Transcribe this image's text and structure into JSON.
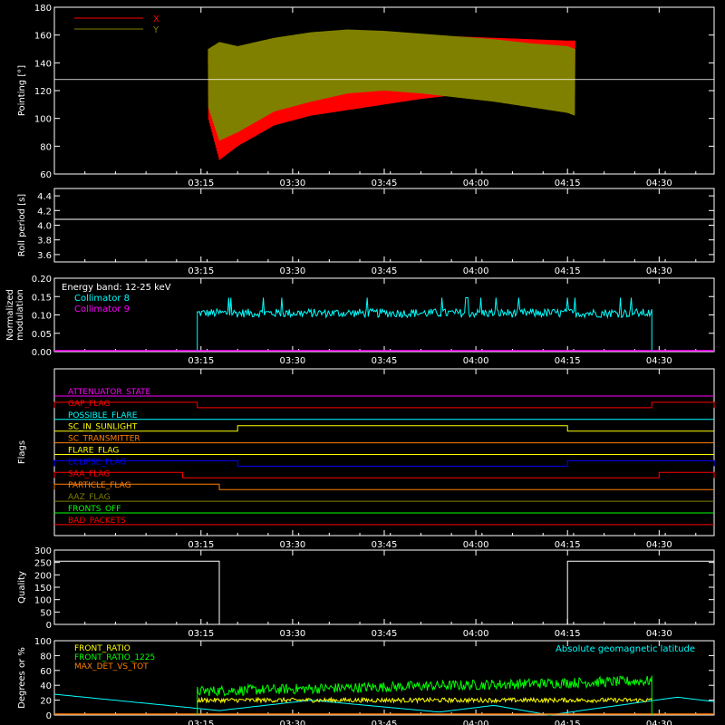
{
  "x_ticks": [
    "03:15",
    "03:30",
    "03:45",
    "04:00",
    "04:15",
    "04:30"
  ],
  "chart_data": [
    {
      "id": "pointing",
      "type": "line",
      "ylabel": "Pointing [°]",
      "ylim": [
        60,
        180
      ],
      "yticks": [
        "60",
        "80",
        "100",
        "120",
        "140",
        "160",
        "180"
      ],
      "legend": [
        {
          "name": "X",
          "color": "#ff0000"
        },
        {
          "name": "Y",
          "color": "#808000"
        }
      ],
      "reference_line": 128,
      "envelopes": [
        {
          "name": "X",
          "color": "#ff0000",
          "t": [
            3.27,
            3.3,
            3.35,
            3.45,
            3.55,
            3.65,
            3.75,
            3.85,
            3.95,
            4.05,
            4.15,
            4.25,
            4.27
          ],
          "upper": [
            145,
            152,
            148,
            153,
            156,
            158,
            158,
            159,
            159,
            158,
            157,
            156,
            156
          ],
          "lower": [
            100,
            70,
            80,
            95,
            102,
            106,
            110,
            114,
            117,
            118,
            119,
            118,
            118
          ]
        },
        {
          "name": "Y",
          "color": "#808000",
          "t": [
            3.27,
            3.3,
            3.35,
            3.45,
            3.55,
            3.65,
            3.75,
            3.85,
            3.95,
            4.05,
            4.15,
            4.25,
            4.27
          ],
          "upper": [
            150,
            155,
            152,
            158,
            162,
            164,
            163,
            161,
            159,
            157,
            154,
            152,
            150
          ],
          "lower": [
            108,
            84,
            90,
            105,
            112,
            118,
            120,
            118,
            115,
            112,
            108,
            104,
            102
          ]
        }
      ]
    },
    {
      "id": "roll",
      "type": "line",
      "ylabel": "Roll period [s]",
      "ylim": [
        3.5,
        4.5
      ],
      "yticks": [
        "3.6",
        "3.8",
        "4.0",
        "4.2",
        "4.4"
      ],
      "series": [
        {
          "name": "roll period",
          "color": "#ffffff",
          "value": 4.08
        }
      ]
    },
    {
      "id": "modulation",
      "type": "line",
      "ylabel": "Normalized modulation",
      "ylim": [
        0,
        0.2
      ],
      "yticks": [
        "0.00",
        "0.05",
        "0.10",
        "0.15",
        "0.20"
      ],
      "annotations": [
        "Energy band: 12-25 keV"
      ],
      "legend": [
        {
          "name": "Collimator 8",
          "color": "#00ffff"
        },
        {
          "name": "Collimator 9",
          "color": "#ff00ff"
        }
      ],
      "series": [
        {
          "name": "Collimator 8",
          "color": "#00ffff",
          "t_start": 3.24,
          "t_end": 4.48,
          "mean": 0.105,
          "noise": 0.012
        },
        {
          "name": "Collimator 9",
          "color": "#ff00ff",
          "value": 0
        }
      ]
    },
    {
      "id": "flags",
      "type": "line",
      "ylabel": "Flags",
      "flags": [
        {
          "name": "ATTENUATOR_STATE",
          "color": "#ff00ff",
          "low_segments": []
        },
        {
          "name": "GAP_FLAG",
          "color": "#ff0000",
          "high_segments": [
            [
              2.85,
              3.24
            ],
            [
              4.48,
              4.65
            ]
          ]
        },
        {
          "name": "POSSIBLE_FLARE",
          "color": "#00ffff",
          "high_segments": []
        },
        {
          "name": "SC_IN_SUNLIGHT",
          "color": "#ffff00",
          "high_segments": [
            [
              3.35,
              4.25
            ]
          ]
        },
        {
          "name": "SC_TRANSMITTER",
          "color": "#ff7f00",
          "high_segments": []
        },
        {
          "name": "FLARE_FLAG",
          "color": "#ffff00",
          "high_segments": []
        },
        {
          "name": "ECLIPSE_FLAG",
          "color": "#0000ff",
          "high_segments": [
            [
              2.85,
              3.35
            ],
            [
              4.25,
              4.65
            ]
          ]
        },
        {
          "name": "SAA_FLAG",
          "color": "#ff0000",
          "high_segments": [
            [
              2.85,
              3.2
            ],
            [
              4.5,
              4.65
            ]
          ]
        },
        {
          "name": "PARTICLE_FLAG",
          "color": "#ff7f00",
          "high_segments": [
            [
              2.85,
              3.3
            ]
          ]
        },
        {
          "name": "AAZ_FLAG",
          "color": "#808000",
          "high_segments": []
        },
        {
          "name": "FRONTS_OFF",
          "color": "#00ff00",
          "high_segments": []
        },
        {
          "name": "BAD_PACKETS",
          "color": "#ff0000",
          "high_segments": []
        }
      ]
    },
    {
      "id": "quality",
      "type": "line",
      "ylabel": "Quality",
      "ylim": [
        0,
        300
      ],
      "yticks": [
        "0",
        "50",
        "100",
        "150",
        "200",
        "250",
        "300"
      ],
      "series": [
        {
          "name": "quality",
          "color": "#ffffff",
          "t": [
            2.85,
            3.3,
            3.3,
            4.25,
            4.25,
            4.65
          ],
          "y": [
            255,
            255,
            0,
            0,
            255,
            255
          ]
        }
      ]
    },
    {
      "id": "ratios",
      "type": "line",
      "ylabel": "Degrees or %",
      "ylim": [
        0,
        100
      ],
      "yticks": [
        "0",
        "20",
        "40",
        "60",
        "80",
        "100"
      ],
      "legend": [
        {
          "name": "FRONT_RATIO",
          "color": "#ffff00"
        },
        {
          "name": "FRONT_RATIO_1225",
          "color": "#00ff00"
        },
        {
          "name": "MAX_DET_VS_TOT",
          "color": "#ff7f00"
        }
      ],
      "annotations": [
        "Absolute geomagnetic latitude"
      ],
      "series": [
        {
          "name": "FRONT_RATIO",
          "color": "#ffff00",
          "t_start": 3.24,
          "t_end": 4.48,
          "mean": 20,
          "noise": 3
        },
        {
          "name": "FRONT_RATIO_1225",
          "color": "#00ff00",
          "t_start": 3.24,
          "t_end": 4.48,
          "mean_start": 32,
          "mean_end": 46,
          "noise": 7
        },
        {
          "name": "MAX_DET_VS_TOT",
          "color": "#ff7f00",
          "value": 0
        },
        {
          "name": "Absolute geomagnetic latitude",
          "color": "#00ffff",
          "t": [
            2.85,
            3.3,
            3.55,
            3.9,
            4.05,
            4.2,
            4.55,
            4.65
          ],
          "y": [
            28,
            6,
            20,
            4,
            13,
            0,
            24,
            18
          ]
        }
      ]
    }
  ]
}
